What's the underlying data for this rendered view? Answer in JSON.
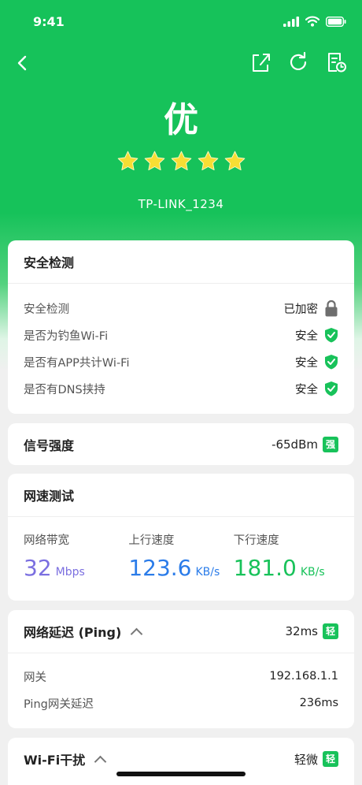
{
  "status_bar": {
    "time": "9:41"
  },
  "header": {
    "grade": "优",
    "rating": 5,
    "ssid": "TP-LINK_1234"
  },
  "security": {
    "title": "安全检测",
    "rows": [
      {
        "label": "安全检测",
        "value": "已加密",
        "icon": "lock-icon"
      },
      {
        "label": "是否为钓鱼Wi-Fi",
        "value": "安全",
        "icon": "shield-check-icon"
      },
      {
        "label": "是否有APP共计Wi-Fi",
        "value": "安全",
        "icon": "shield-check-icon"
      },
      {
        "label": "是否有DNS挟持",
        "value": "安全",
        "icon": "shield-check-icon"
      }
    ]
  },
  "signal": {
    "title": "信号强度",
    "value": "-65dBm",
    "badge": "强"
  },
  "speed": {
    "title": "网速测试",
    "items": [
      {
        "label": "网络带宽",
        "value": "32",
        "unit": "Mbps",
        "color": "#7b6fe0"
      },
      {
        "label": "上行速度",
        "value": "123.6",
        "unit": "KB/s",
        "color": "#2b7ce9"
      },
      {
        "label": "下行速度",
        "value": "181.0",
        "unit": "KB/s",
        "color": "#18c25a"
      }
    ]
  },
  "ping": {
    "title": "网络延迟 (Ping)",
    "value": "32ms",
    "badge": "轻",
    "rows": [
      {
        "label": "网关",
        "value": "192.168.1.1"
      },
      {
        "label": "Ping网关延迟",
        "value": "236ms"
      }
    ]
  },
  "interference": {
    "title": "Wi-Fi干扰",
    "value": "轻微",
    "badge": "轻"
  },
  "colors": {
    "brand_green": "#16c25a",
    "badge_green": "#18c25a"
  }
}
